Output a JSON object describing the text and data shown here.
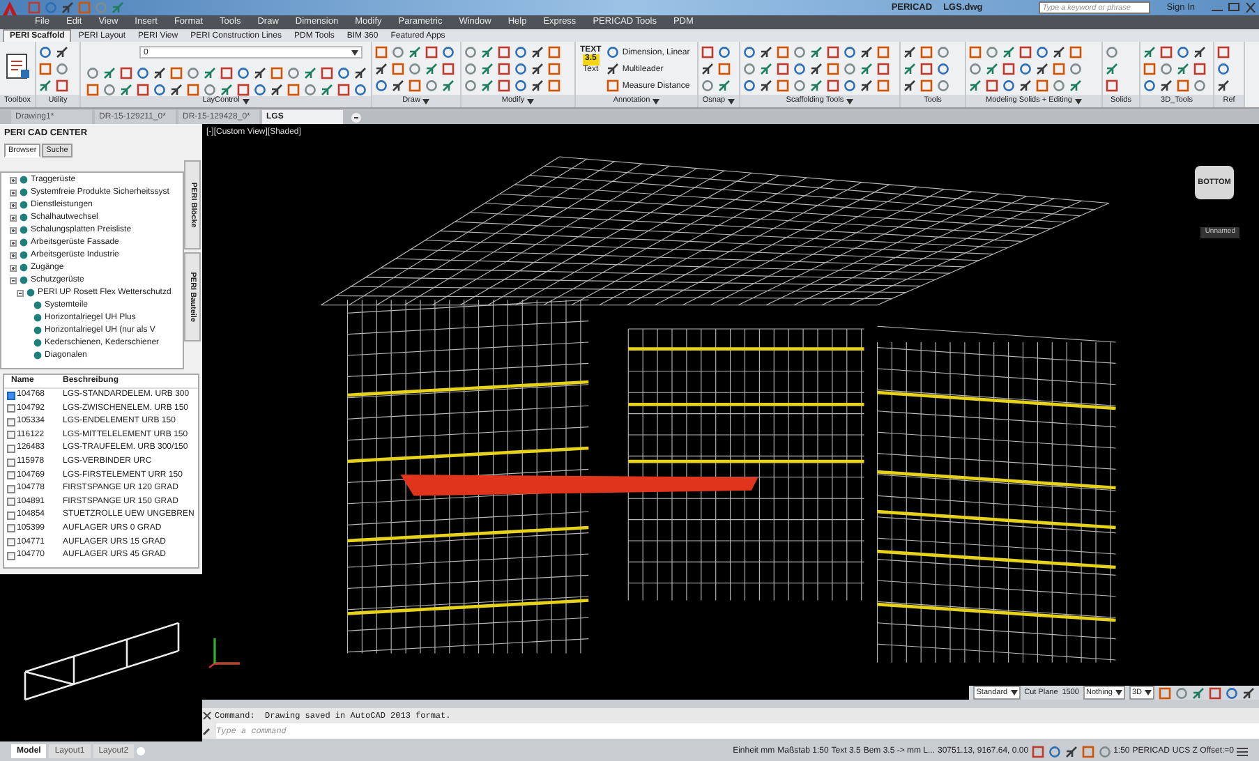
{
  "title_bar": {
    "app": "PERICAD",
    "file": "LGS.dwg",
    "search": {
      "placeholder": "Type a keyword or phrase"
    },
    "sign_in": "Sign In"
  },
  "menu": [
    "File",
    "Edit",
    "View",
    "Insert",
    "Format",
    "Tools",
    "Draw",
    "Dimension",
    "Modify",
    "Parametric",
    "Window",
    "Help",
    "Express",
    "PERICAD Tools",
    "PDM"
  ],
  "ribbon_tabs": [
    {
      "label": "PERI Scaffold",
      "selected": true
    },
    {
      "label": "PERI Layout",
      "selected": false
    },
    {
      "label": "PERI View",
      "selected": false
    },
    {
      "label": "PERI Construction Lines",
      "selected": false
    },
    {
      "label": "PDM Tools",
      "selected": false
    },
    {
      "label": "BIM 360",
      "selected": false
    },
    {
      "label": "Featured Apps",
      "selected": false
    }
  ],
  "ribbon_panels": [
    {
      "title": "Toolbox",
      "kind": "large",
      "dropdown": false
    },
    {
      "title": "Utility",
      "kind": "icons",
      "dropdown": false
    },
    {
      "title": "LayControl",
      "kind": "layers",
      "dropdown": true
    },
    {
      "title": "Draw",
      "kind": "icons",
      "dropdown": true
    },
    {
      "title": "Modify",
      "kind": "icons",
      "dropdown": true
    },
    {
      "title": "Annotation",
      "kind": "annotation",
      "dropdown": true
    },
    {
      "title": "Osnap",
      "kind": "icons",
      "dropdown": true
    },
    {
      "title": "Scaffolding Tools",
      "kind": "icons",
      "dropdown": true
    },
    {
      "title": "Tools",
      "kind": "icons",
      "dropdown": false
    },
    {
      "title": "Modeling Solids + Editing",
      "kind": "icons",
      "dropdown": true
    },
    {
      "title": "Solids",
      "kind": "icons",
      "dropdown": false
    },
    {
      "title": "3D_Tools",
      "kind": "icons",
      "dropdown": false
    },
    {
      "title": "Ref",
      "kind": "icons",
      "dropdown": false
    }
  ],
  "layer_field": {
    "value": "0"
  },
  "annotation": {
    "badge_top": "TEXT",
    "badge_value": "3.5",
    "text_label": "Text",
    "tools": [
      "Dimension, Linear",
      "Multileader",
      "Measure Distance"
    ]
  },
  "doc_tabs": [
    {
      "label": "Drawing1*",
      "selected": false
    },
    {
      "label": "DR-15-129211_0*",
      "selected": false
    },
    {
      "label": "DR-15-129428_0*",
      "selected": false
    },
    {
      "label": "LGS",
      "selected": true
    }
  ],
  "cad_center": {
    "title": "PERI CAD CENTER",
    "tabs": [
      {
        "label": "Browser",
        "selected": true
      },
      {
        "label": "Suche",
        "selected": false
      }
    ],
    "tree": [
      {
        "label": "Traggerüste",
        "expanded": false
      },
      {
        "label": "Systemfreie Produkte Sicherheitssyst",
        "expanded": false
      },
      {
        "label": "Dienstleistungen",
        "expanded": false
      },
      {
        "label": "Schalhautwechsel",
        "expanded": false
      },
      {
        "label": "Schalungsplatten Preisliste",
        "expanded": false
      },
      {
        "label": "Arbeitsgerüste Fassade",
        "expanded": false
      },
      {
        "label": "Arbeitsgerüste Industrie",
        "expanded": false
      },
      {
        "label": "Zugänge",
        "expanded": false
      },
      {
        "label": "Schutzgerüste",
        "expanded": true,
        "children": [
          {
            "label": "PERI UP Rosett Flex Wetterschutzd",
            "expanded": true,
            "children": [
              {
                "label": "Systemteile"
              },
              {
                "label": "Horizontalriegel UH Plus"
              },
              {
                "label": "Horizontalriegel UH (nur als V"
              },
              {
                "label": "Kederschienen, Kederschiener"
              },
              {
                "label": "Diagonalen"
              }
            ]
          }
        ]
      }
    ],
    "side_tabs": [
      "PERI Blöcke",
      "PERI Bauteile"
    ],
    "list": {
      "columns": [
        "Name",
        "Beschreibung"
      ],
      "rows": [
        {
          "name": "104768",
          "description": "LGS-STANDARDELEM. URB 300",
          "selected": true
        },
        {
          "name": "104792",
          "description": "LGS-ZWISCHENELEM. URB 150",
          "selected": false
        },
        {
          "name": "105334",
          "description": "LGS-ENDELEMENT URB 150",
          "selected": false
        },
        {
          "name": "116122",
          "description": "LGS-MITTELELEMENT URB 150",
          "selected": false
        },
        {
          "name": "126483",
          "description": "LGS-TRAUFELEM. URB 300/150",
          "selected": false
        },
        {
          "name": "115978",
          "description": "LGS-VERBINDER URC",
          "selected": false
        },
        {
          "name": "104769",
          "description": "LGS-FIRSTELEMENT URR 150",
          "selected": false
        },
        {
          "name": "104778",
          "description": "FIRSTSPANGE UR 120 GRAD",
          "selected": false
        },
        {
          "name": "104891",
          "description": "FIRSTSPANGE UR 150 GRAD",
          "selected": false
        },
        {
          "name": "104854",
          "description": "STUETZROLLE UEW UNGEBREN",
          "selected": false
        },
        {
          "name": "105399",
          "description": "AUFLAGER URS 0 GRAD",
          "selected": false
        },
        {
          "name": "104771",
          "description": "AUFLAGER URS 15 GRAD",
          "selected": false
        },
        {
          "name": "104770",
          "description": "AUFLAGER URS 45 GRAD",
          "selected": false
        }
      ]
    }
  },
  "viewport": {
    "label": "[-][Custom View][Shaded]",
    "viewcube": "BOTTOM",
    "ucs": "Unnamed"
  },
  "viewport_toolbar": {
    "style": "Standard",
    "cut_plane_label": "Cut Plane",
    "cut_plane_value": "1500",
    "snap": "Nothing",
    "view": "3D"
  },
  "command": {
    "history": "Command:  Drawing saved in AutoCAD 2013 format.",
    "placeholder": "Type a command"
  },
  "layout_tabs": [
    {
      "label": "Model",
      "selected": true
    },
    {
      "label": "Layout1",
      "selected": false
    },
    {
      "label": "Layout2",
      "selected": false
    }
  ],
  "status": [
    "Einheit mm",
    "Maßstab 1:50",
    "Text 3.5",
    "Bem 3.5 -> mm L...",
    "30751.13, 9167.64, 0.00",
    "1:50",
    "PERICAD",
    "UCS Z Offset:=0"
  ]
}
